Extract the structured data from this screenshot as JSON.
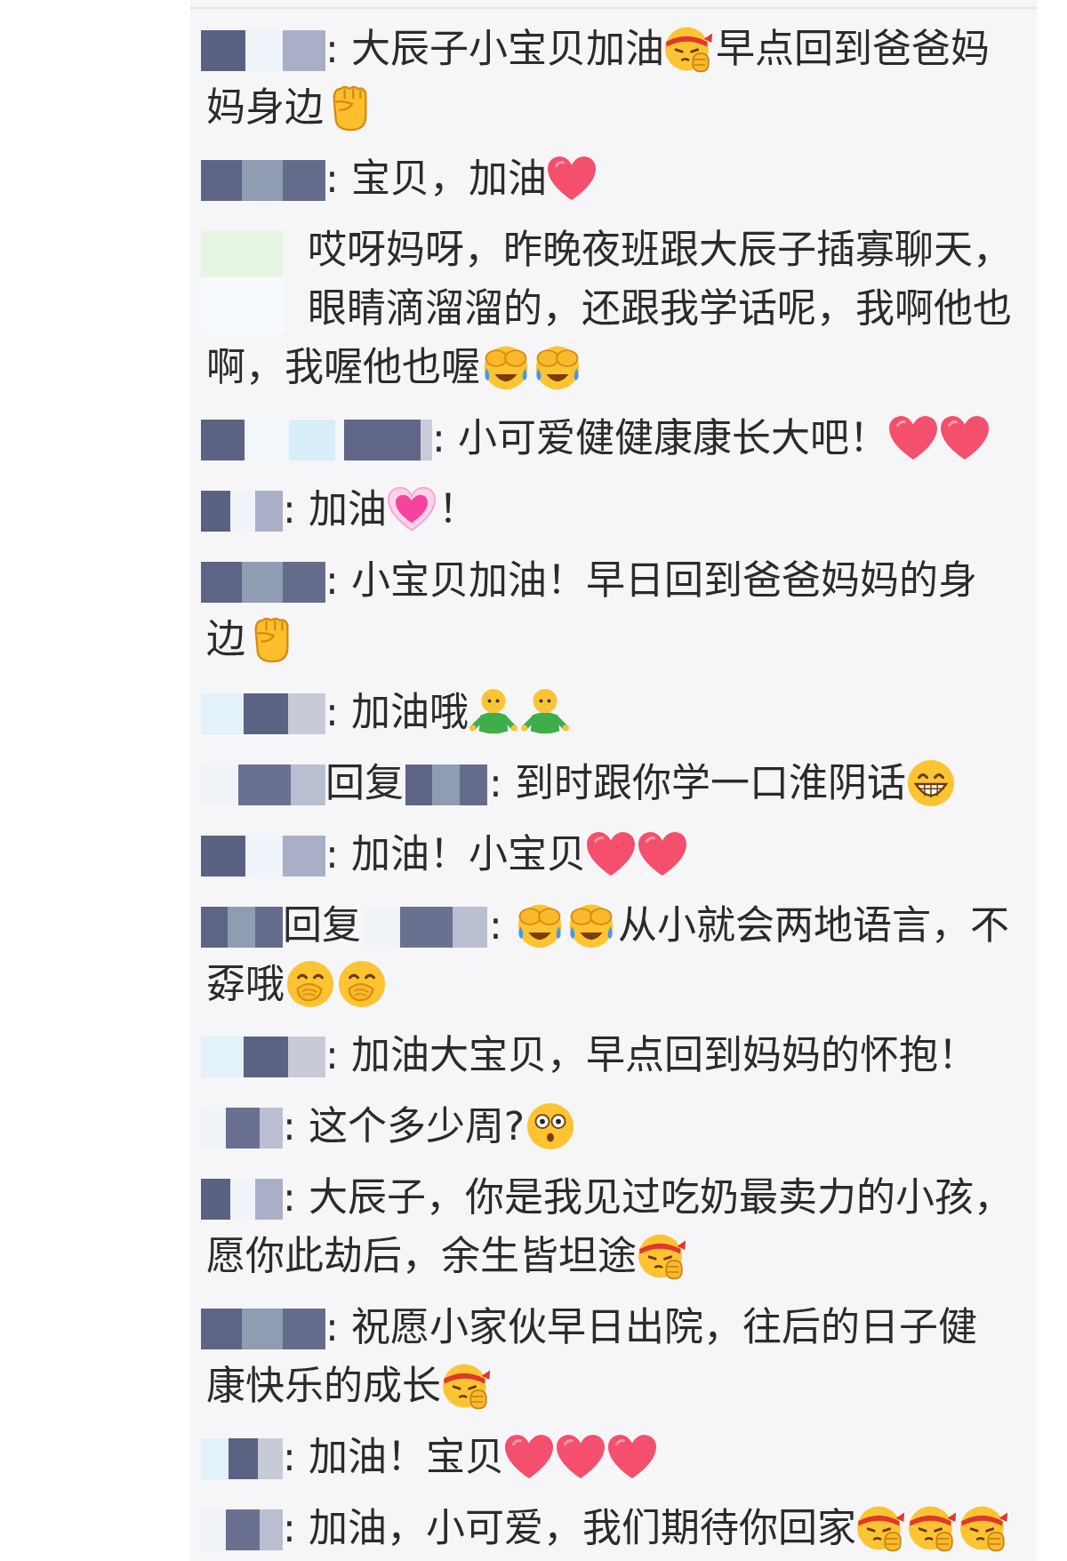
{
  "comments": [
    {
      "segments": [
        {
          "kind": "blur"
        },
        {
          "kind": "text",
          "text": ": 大辰子小宝贝加油"
        },
        {
          "kind": "strive"
        },
        {
          "kind": "text",
          "text": "早点回到爸爸妈妈身边"
        },
        {
          "kind": "fist"
        }
      ]
    },
    {
      "segments": [
        {
          "kind": "blur"
        },
        {
          "kind": "text",
          "text": ": 宝贝，加油"
        },
        {
          "kind": "heart"
        }
      ]
    },
    {
      "segments": [
        {
          "kind": "blurtall"
        },
        {
          "kind": "text",
          "text": "哎呀妈呀，昨晚夜班跟大辰子插寡聊天，眼睛滴溜溜的，还跟我学话呢，我啊他也啊，我喔他也喔"
        },
        {
          "kind": "facepalm"
        },
        {
          "kind": "facepalm"
        }
      ]
    },
    {
      "segments": [
        {
          "kind": "blurwide"
        },
        {
          "kind": "text",
          "text": ": 小可爱健健康康长大吧！"
        },
        {
          "kind": "heart"
        },
        {
          "kind": "heart"
        }
      ]
    },
    {
      "segments": [
        {
          "kind": "blurshort"
        },
        {
          "kind": "text",
          "text": ": 加油"
        },
        {
          "kind": "pinkheart"
        },
        {
          "kind": "text",
          "text": "！"
        }
      ]
    },
    {
      "segments": [
        {
          "kind": "blur"
        },
        {
          "kind": "text",
          "text": ": 小宝贝加油！早日回到爸爸妈妈的身边"
        },
        {
          "kind": "fist"
        }
      ]
    },
    {
      "segments": [
        {
          "kind": "blur"
        },
        {
          "kind": "text",
          "text": ": 加油哦"
        },
        {
          "kind": "hug"
        },
        {
          "kind": "hug"
        }
      ]
    },
    {
      "segments": [
        {
          "kind": "blur"
        },
        {
          "kind": "text",
          "text": "回复"
        },
        {
          "kind": "blurshort"
        },
        {
          "kind": "text",
          "text": ": 到时跟你学一口淮阴话"
        },
        {
          "kind": "grin"
        }
      ]
    },
    {
      "segments": [
        {
          "kind": "blur"
        },
        {
          "kind": "text",
          "text": ": 加油！小宝贝"
        },
        {
          "kind": "heart"
        },
        {
          "kind": "heart"
        }
      ]
    },
    {
      "segments": [
        {
          "kind": "blurshort"
        },
        {
          "kind": "text",
          "text": "回复"
        },
        {
          "kind": "blur"
        },
        {
          "kind": "text",
          "text": ": "
        },
        {
          "kind": "facepalm"
        },
        {
          "kind": "facepalm"
        },
        {
          "kind": "text",
          "text": "从小就会两地语言，不孬哦"
        },
        {
          "kind": "giggle"
        },
        {
          "kind": "giggle"
        }
      ]
    },
    {
      "segments": [
        {
          "kind": "blur"
        },
        {
          "kind": "text",
          "text": ": 加油大宝贝，早点回到妈妈的怀抱！"
        }
      ]
    },
    {
      "segments": [
        {
          "kind": "blurshort"
        },
        {
          "kind": "text",
          "text": ": 这个多少周?"
        },
        {
          "kind": "shock"
        }
      ]
    },
    {
      "segments": [
        {
          "kind": "blurshort"
        },
        {
          "kind": "text",
          "text": ": 大辰子，你是我见过吃奶最卖力的小孩，愿你此劫后，余生皆坦途"
        },
        {
          "kind": "strive"
        }
      ]
    },
    {
      "segments": [
        {
          "kind": "blur"
        },
        {
          "kind": "text",
          "text": ": 祝愿小家伙早日出院，往后的日子健康快乐的成长"
        },
        {
          "kind": "strive"
        }
      ]
    },
    {
      "segments": [
        {
          "kind": "blurshort"
        },
        {
          "kind": "text",
          "text": ": 加油！宝贝"
        },
        {
          "kind": "heart"
        },
        {
          "kind": "heart"
        },
        {
          "kind": "heart"
        }
      ]
    },
    {
      "segments": [
        {
          "kind": "blurshort"
        },
        {
          "kind": "text",
          "text": ": 加油，小可爱，我们期待你回家"
        },
        {
          "kind": "strive"
        },
        {
          "kind": "strive"
        },
        {
          "kind": "strive"
        }
      ]
    }
  ]
}
